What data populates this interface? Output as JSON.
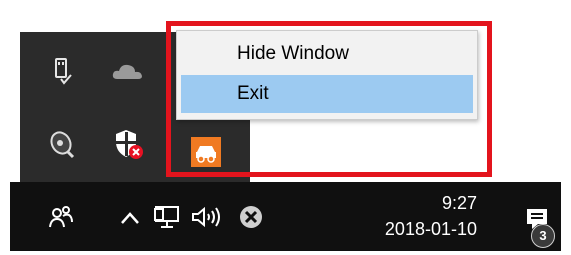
{
  "context_menu": {
    "items": [
      {
        "label": "Hide Window",
        "highlighted": false
      },
      {
        "label": "Exit",
        "highlighted": true
      }
    ],
    "highlight_color": "#9ccaf1"
  },
  "tray_flyout": {
    "icons": [
      "usb-safe-remove-icon",
      "onedrive-cloud-icon",
      "speaker-sound-icon",
      "security-shield-warning-icon",
      "app-orange-car-icon"
    ]
  },
  "taskbar": {
    "clock": {
      "time": "9:27",
      "date": "2018-01-10"
    },
    "notification_count": "3",
    "icons": [
      "people-icon",
      "chevron-up-icon",
      "network-icon",
      "volume-icon",
      "close-circle-icon",
      "action-center-icon"
    ]
  },
  "annotation": {
    "highlight_box_color": "#e3141d"
  }
}
